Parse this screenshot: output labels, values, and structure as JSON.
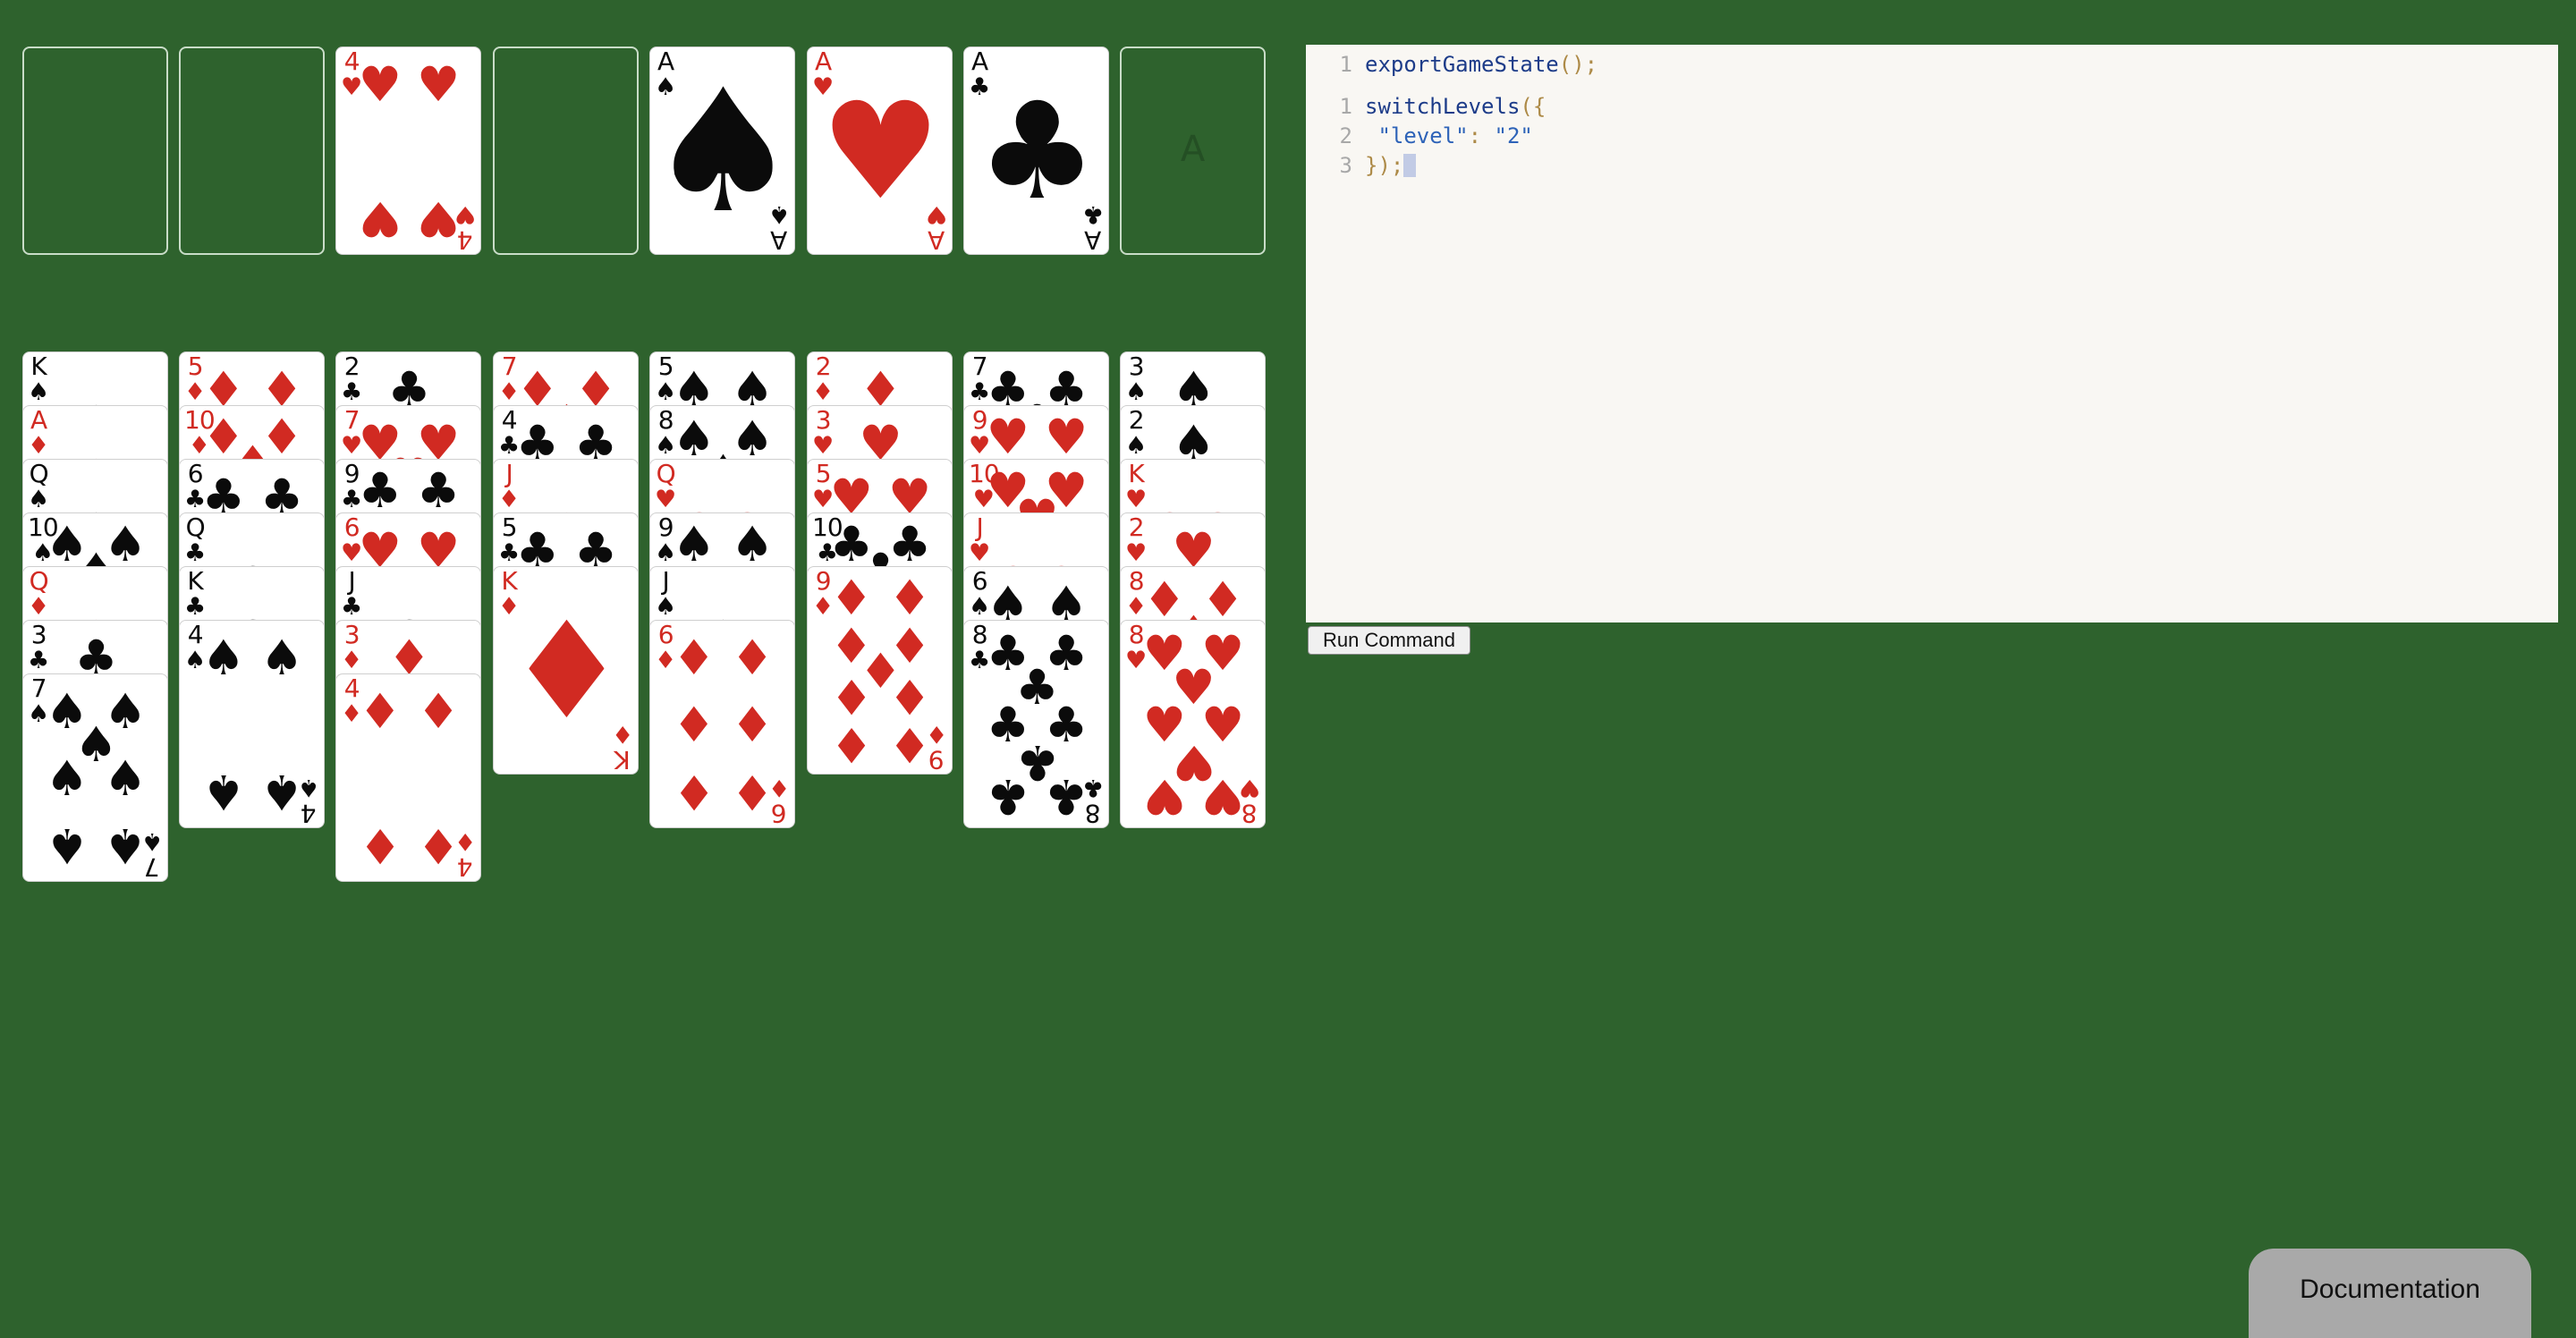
{
  "foundation": [
    {
      "slot": "empty"
    },
    {
      "slot": "empty"
    },
    {
      "slot": "card",
      "card": {
        "rank": "4",
        "suit": "hearts"
      }
    },
    {
      "slot": "empty"
    },
    {
      "slot": "card",
      "card": {
        "rank": "A",
        "suit": "spades"
      }
    },
    {
      "slot": "card",
      "card": {
        "rank": "A",
        "suit": "hearts"
      }
    },
    {
      "slot": "card",
      "card": {
        "rank": "A",
        "suit": "clubs"
      }
    },
    {
      "slot": "empty",
      "label": "A"
    }
  ],
  "tableau": [
    [
      {
        "rank": "K",
        "suit": "spades"
      },
      {
        "rank": "A",
        "suit": "diamonds"
      },
      {
        "rank": "Q",
        "suit": "spades"
      },
      {
        "rank": "10",
        "suit": "spades"
      },
      {
        "rank": "Q",
        "suit": "diamonds"
      },
      {
        "rank": "3",
        "suit": "clubs"
      },
      {
        "rank": "7",
        "suit": "spades"
      }
    ],
    [
      {
        "rank": "5",
        "suit": "diamonds"
      },
      {
        "rank": "10",
        "suit": "diamonds"
      },
      {
        "rank": "6",
        "suit": "clubs"
      },
      {
        "rank": "Q",
        "suit": "clubs"
      },
      {
        "rank": "K",
        "suit": "clubs"
      },
      {
        "rank": "4",
        "suit": "spades"
      }
    ],
    [
      {
        "rank": "2",
        "suit": "clubs"
      },
      {
        "rank": "7",
        "suit": "hearts"
      },
      {
        "rank": "9",
        "suit": "clubs"
      },
      {
        "rank": "6",
        "suit": "hearts"
      },
      {
        "rank": "J",
        "suit": "clubs"
      },
      {
        "rank": "3",
        "suit": "diamonds"
      },
      {
        "rank": "4",
        "suit": "diamonds"
      }
    ],
    [
      {
        "rank": "7",
        "suit": "diamonds"
      },
      {
        "rank": "4",
        "suit": "clubs"
      },
      {
        "rank": "J",
        "suit": "diamonds"
      },
      {
        "rank": "5",
        "suit": "clubs"
      },
      {
        "rank": "K",
        "suit": "diamonds"
      }
    ],
    [
      {
        "rank": "5",
        "suit": "spades"
      },
      {
        "rank": "8",
        "suit": "spades"
      },
      {
        "rank": "Q",
        "suit": "hearts"
      },
      {
        "rank": "9",
        "suit": "spades"
      },
      {
        "rank": "J",
        "suit": "spades"
      },
      {
        "rank": "6",
        "suit": "diamonds"
      }
    ],
    [
      {
        "rank": "2",
        "suit": "diamonds"
      },
      {
        "rank": "3",
        "suit": "hearts"
      },
      {
        "rank": "5",
        "suit": "hearts"
      },
      {
        "rank": "10",
        "suit": "clubs"
      },
      {
        "rank": "9",
        "suit": "diamonds"
      }
    ],
    [
      {
        "rank": "7",
        "suit": "clubs"
      },
      {
        "rank": "9",
        "suit": "hearts"
      },
      {
        "rank": "10",
        "suit": "hearts"
      },
      {
        "rank": "J",
        "suit": "hearts"
      },
      {
        "rank": "6",
        "suit": "spades"
      },
      {
        "rank": "8",
        "suit": "clubs"
      }
    ],
    [
      {
        "rank": "3",
        "suit": "spades"
      },
      {
        "rank": "2",
        "suit": "spades"
      },
      {
        "rank": "K",
        "suit": "hearts"
      },
      {
        "rank": "2",
        "suit": "hearts"
      },
      {
        "rank": "8",
        "suit": "diamonds"
      },
      {
        "rank": "8",
        "suit": "hearts"
      }
    ]
  ],
  "suit_symbols": {
    "spades": "♠",
    "hearts": "♥",
    "diamonds": "♦",
    "clubs": "♣"
  },
  "colors": {
    "table": "#2e622d",
    "red": "#d12a22",
    "black": "#0b0b0b",
    "editor_bg": "#f9f7f3"
  },
  "editor": {
    "blocks": [
      [
        {
          "num": "1",
          "tokens": [
            {
              "t": "exportGameState",
              "c": "fn"
            },
            {
              "t": "();",
              "c": "punc"
            }
          ]
        }
      ],
      [
        {
          "num": "1",
          "tokens": [
            {
              "t": "switchLevels",
              "c": "fn"
            },
            {
              "t": "({",
              "c": "punc"
            }
          ]
        },
        {
          "num": "2",
          "tokens": [
            {
              "t": " \"level\"",
              "c": "str"
            },
            {
              "t": ": ",
              "c": "punc"
            },
            {
              "t": "\"2\"",
              "c": "str"
            }
          ]
        },
        {
          "num": "3",
          "tokens": [
            {
              "t": "});",
              "c": "punc"
            },
            {
              "t": "",
              "c": "cursor"
            }
          ]
        }
      ]
    ]
  },
  "buttons": {
    "run_command": "Run Command",
    "documentation": "Documentation"
  }
}
